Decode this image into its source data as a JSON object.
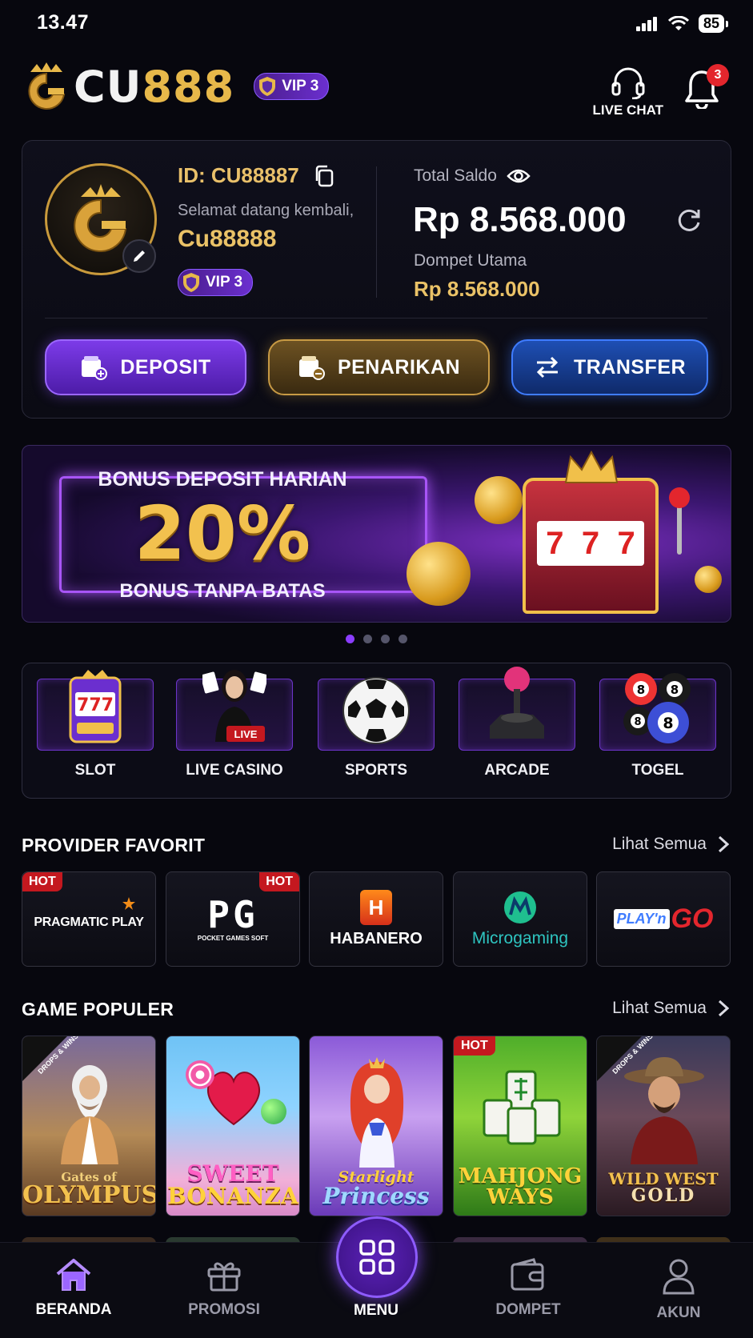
{
  "status_bar": {
    "time": "13.47",
    "battery": "85"
  },
  "header": {
    "logo_prefix": "CU",
    "logo_number": "888",
    "vip_label": "VIP 3",
    "live_chat_label": "LIVE CHAT",
    "notification_count": "3"
  },
  "account": {
    "id_label": "ID: CU88887",
    "welcome_text": "Selamat datang kembali,",
    "username": "Cu88888",
    "vip_label": "VIP 3",
    "total_label": "Total Saldo",
    "total_amount": "Rp 8.568.000",
    "wallet_label": "Dompet Utama",
    "wallet_amount": "Rp 8.568.000"
  },
  "actions": {
    "deposit": "DEPOSIT",
    "withdraw": "PENARIKAN",
    "transfer": "TRANSFER"
  },
  "banner": {
    "line1": "BONUS DEPOSIT HARIAN",
    "line2": "20%",
    "line3": "BONUS TANPA BATAS",
    "slot_reels": [
      "7",
      "7",
      "7"
    ],
    "slides": 4,
    "active_slide": 0
  },
  "categories": [
    {
      "label": "SLOT",
      "icon": "slot-machine-icon"
    },
    {
      "label": "LIVE CASINO",
      "icon": "live-dealer-icon",
      "badge": "LIVE"
    },
    {
      "label": "SPORTS",
      "icon": "soccer-ball-icon"
    },
    {
      "label": "ARCADE",
      "icon": "joystick-icon"
    },
    {
      "label": "TOGEL",
      "icon": "lottery-balls-icon",
      "balls": [
        "8",
        "8",
        "8",
        "8"
      ]
    }
  ],
  "providers": {
    "title": "PROVIDER FAVORIT",
    "see_all": "Lihat Semua",
    "items": [
      {
        "name": "PRAGMATIC PLAY",
        "hot": "HOT"
      },
      {
        "name": "PG",
        "sub": "POCKET GAMES SOFT",
        "hot": "HOT"
      },
      {
        "name": "HABANERO",
        "mark": "H"
      },
      {
        "name": "Microgaming"
      },
      {
        "name": "PLAY'n",
        "accent": "GO"
      }
    ]
  },
  "games": {
    "title": "GAME POPULER",
    "see_all": "Lihat Semua",
    "drops_label": "DROPS & WINS",
    "items": [
      {
        "line1": "Gates of",
        "line2": "OLYMPUS"
      },
      {
        "line1": "SWEET",
        "line2": "BONANZA"
      },
      {
        "line1": "Starlight",
        "line2": "Princess"
      },
      {
        "line1": "MAHJONG",
        "line2": "WAYS",
        "tag": "HOT"
      },
      {
        "line1": "WILD WEST",
        "line2": "GOLD"
      }
    ]
  },
  "nav": {
    "home": "BERANDA",
    "promo": "PROMOSI",
    "menu": "MENU",
    "wallet": "DOMPET",
    "account": "AKUN"
  },
  "colors": {
    "gold": "#eac267",
    "purple": "#7c3be8",
    "blue": "#1e4fb4",
    "hot_red": "#c4181f"
  }
}
